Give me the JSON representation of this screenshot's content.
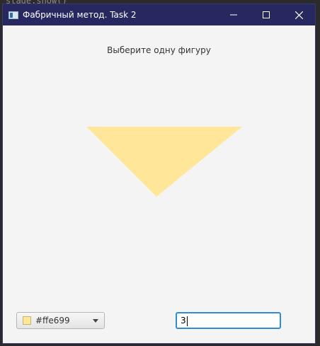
{
  "window": {
    "title": "Фабричный метод. Task 2"
  },
  "background": {
    "code_text": "stage.show()"
  },
  "main": {
    "prompt": "Выберите одну фигуру",
    "shape": {
      "type": "triangle-down",
      "fill": "#ffe699"
    }
  },
  "controls": {
    "color_picker": {
      "value": "#ffe699",
      "swatch": "#ffe699"
    },
    "number_input": {
      "value": "3"
    }
  },
  "colors": {
    "titlebar": "#282860",
    "input_focus": "#2d8ed6"
  }
}
